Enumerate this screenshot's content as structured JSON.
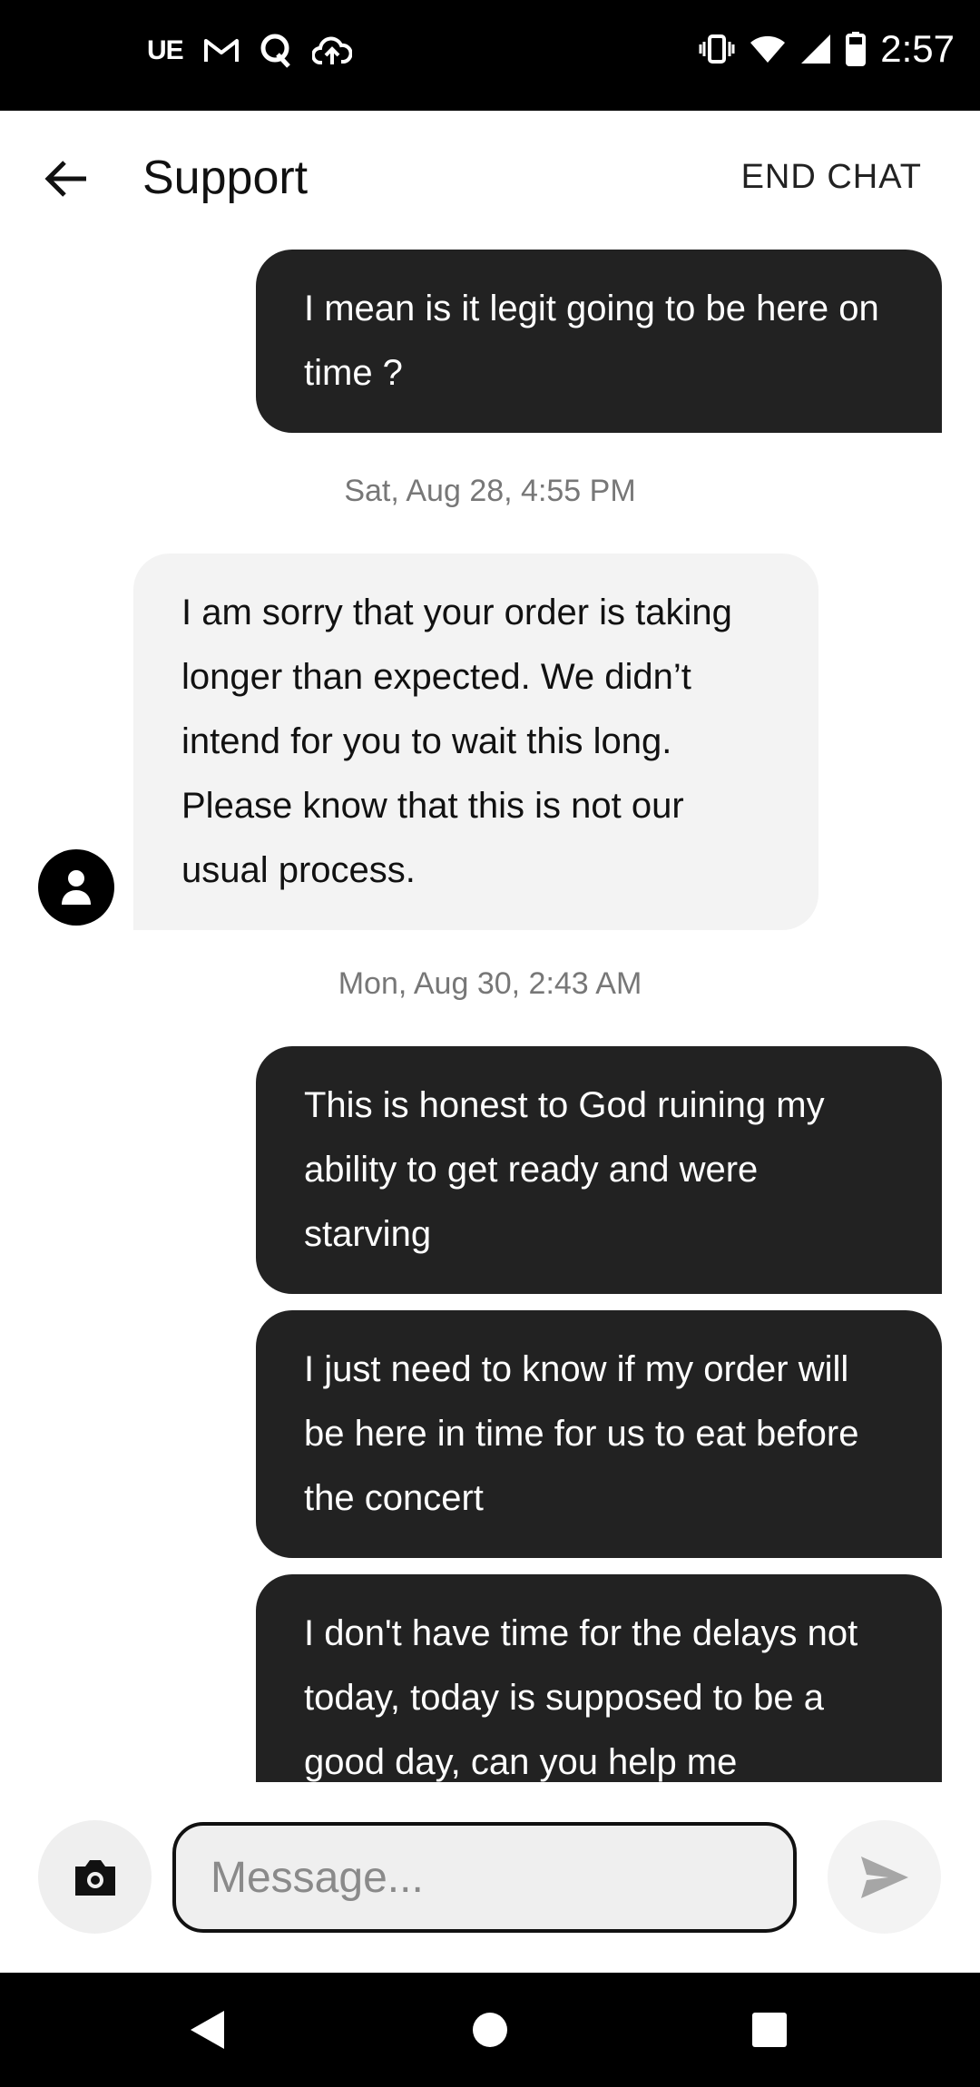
{
  "status_bar": {
    "time": "2:57",
    "left_icons": [
      "ue-icon",
      "gmail-icon",
      "quora-icon",
      "cloud-upload-icon"
    ],
    "ue_label": "UE",
    "right_icons": [
      "vibrate-icon",
      "wifi-icon",
      "cell-signal-icon",
      "battery-icon"
    ]
  },
  "header": {
    "title": "Support",
    "end_chat_label": "END CHAT",
    "back_icon": "arrow-left-icon"
  },
  "messages": [
    {
      "sender": "me",
      "text": "I mean is it legit going to be here on time ?"
    },
    {
      "type": "timestamp",
      "text": "Sat, Aug 28, 4:55 PM"
    },
    {
      "sender": "support",
      "text": "I am sorry that your order is taking longer than expected. We didn’t intend for you to wait this long. Please know that this is not our usual process."
    },
    {
      "type": "timestamp",
      "text": "Mon, Aug 30, 2:43 AM"
    },
    {
      "sender": "me",
      "text": "This is honest to God ruining my ability to get ready and were starving"
    },
    {
      "sender": "me",
      "text": "I just need to know if my order will be here in time for us to eat before the concert"
    },
    {
      "sender": "me",
      "text": "I don't have time for the delays not today, today is supposed to be a good day, can you help me"
    }
  ],
  "composer": {
    "placeholder": "Message...",
    "value": "",
    "camera_icon": "camera-icon",
    "send_icon": "send-icon"
  },
  "colors": {
    "my_bubble": "#222222",
    "support_bubble": "#f3f3f3",
    "timestamp_text": "#777777",
    "status_bar": "#000000"
  }
}
